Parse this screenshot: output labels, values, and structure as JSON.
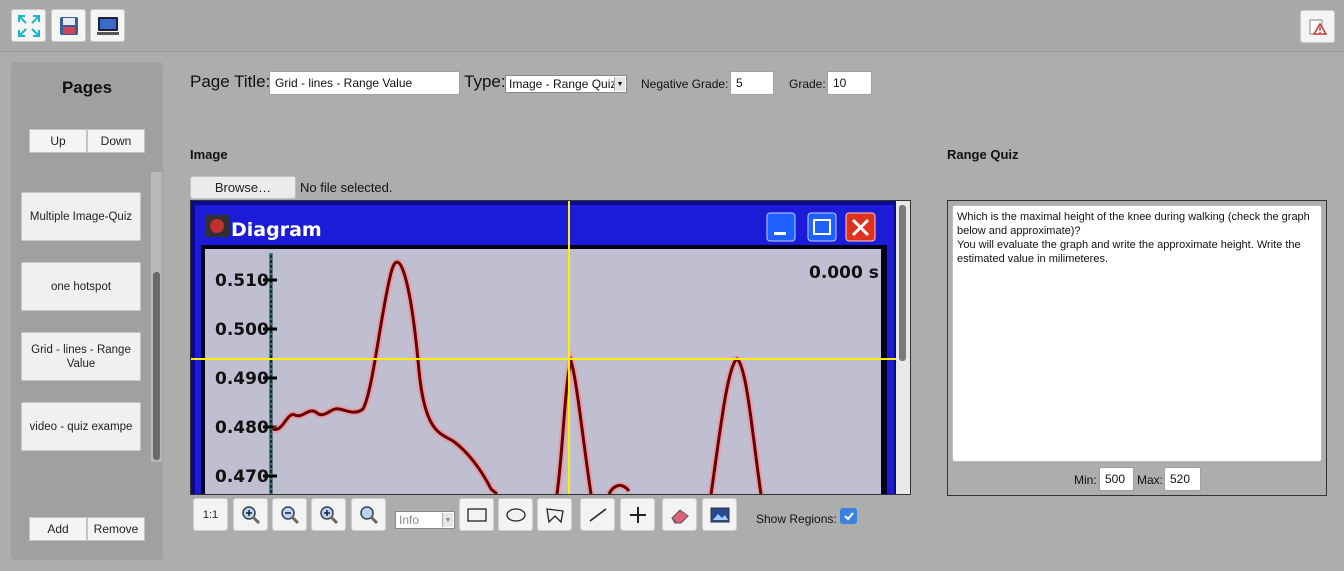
{
  "toolbar": {
    "icons": [
      "fullscreen-icon",
      "save-icon",
      "monitor-icon"
    ],
    "alert_icon": "warning-icon"
  },
  "sidebar": {
    "title": "Pages",
    "up_label": "Up",
    "down_label": "Down",
    "items": [
      {
        "label": "Multiple Image-Quiz"
      },
      {
        "label": "one hotspot"
      },
      {
        "label": "Grid - lines - Range Value"
      },
      {
        "label": "video - quiz exampe"
      }
    ],
    "add_label": "Add",
    "remove_label": "Remove"
  },
  "header": {
    "page_title_label": "Page Title:",
    "page_title_value": "Grid - lines - Range Value",
    "type_label": "Type:",
    "type_value": "Image - Range Quiz",
    "negative_grade_label": "Negative Grade:",
    "negative_grade_value": "5",
    "grade_label": "Grade:",
    "grade_value": "10"
  },
  "image_section": {
    "title": "Image",
    "browse_label": "Browse…",
    "file_status": "No file selected.",
    "window_title": "Diagram",
    "time_readout": "0.000 s",
    "y_ticks": [
      "0.510",
      "0.500",
      "0.490",
      "0.480",
      "0.470"
    ]
  },
  "image_toolbar": {
    "zoom_reset_label": "1:1",
    "info_select_value": "Info",
    "show_regions_label": "Show Regions:",
    "show_regions_checked": true
  },
  "quiz_section": {
    "title": "Range Quiz",
    "question": "Which is the maximal height of the knee during walking (check the graph below and approximate)?\nYou will evaluate the graph and write the approximate height. Write the estimated value in milimeteres.",
    "min_label": "Min:",
    "min_value": "500",
    "max_label": "Max:",
    "max_value": "520"
  }
}
